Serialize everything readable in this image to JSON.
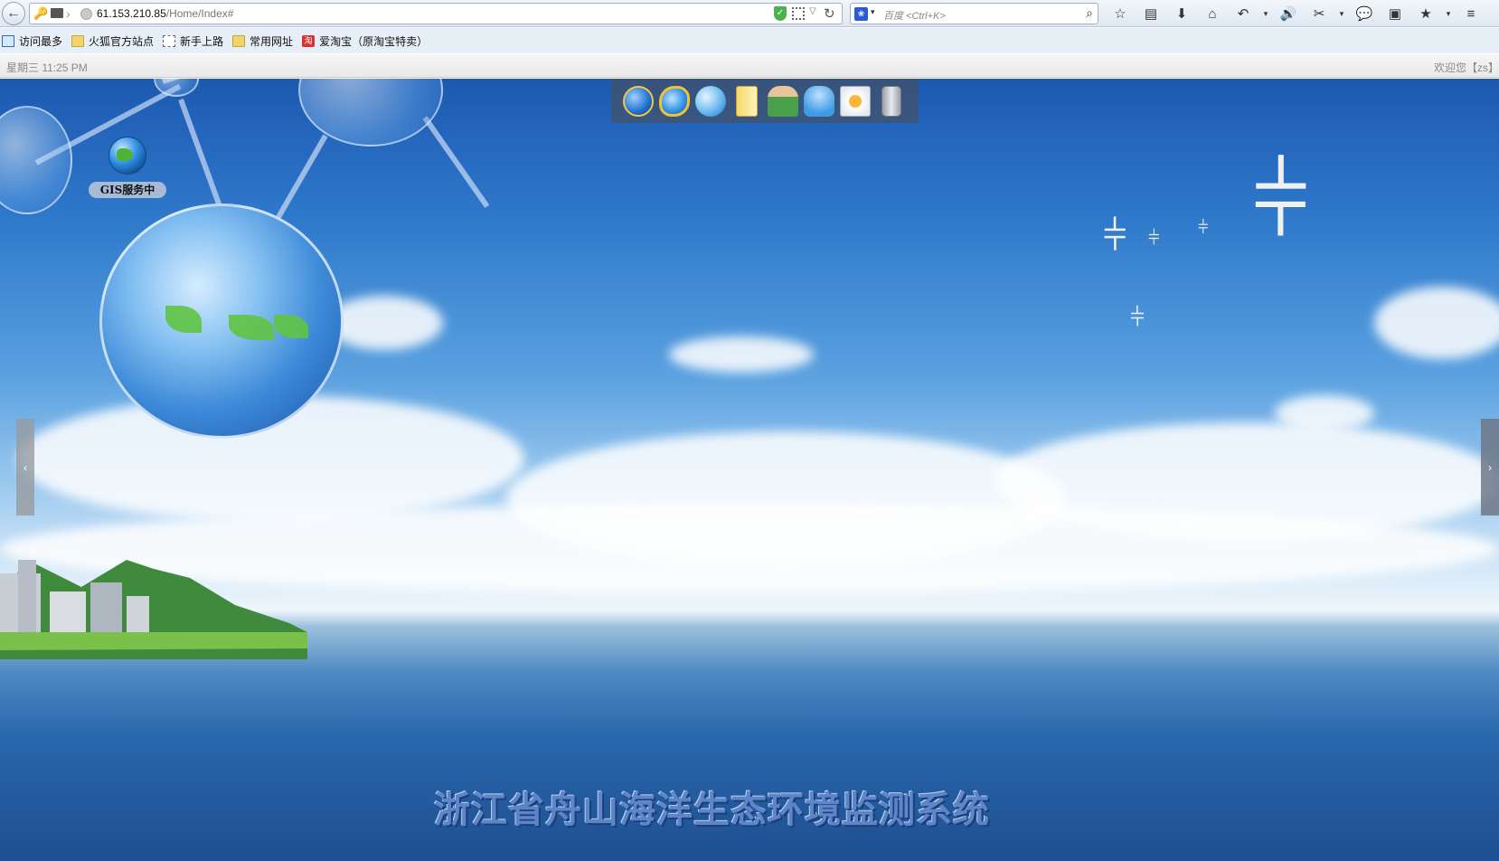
{
  "browser": {
    "url_host": "61.153.210.85",
    "url_path": "/Home/Index#",
    "search_placeholder": "百度 <Ctrl+K>",
    "bookmarks": [
      "访问最多",
      "火狐官方站点",
      "新手上路",
      "常用网址",
      "爱淘宝（原淘宝特卖）"
    ],
    "tools": [
      "star-icon",
      "clipboard-icon",
      "download-icon",
      "home-icon",
      "undo-icon",
      "speaker-icon",
      "crop-icon",
      "chat-icon",
      "reader-icon",
      "addon-icon",
      "menu-icon"
    ]
  },
  "status": {
    "clock": "星期三 11:25 PM",
    "welcome": "欢迎您【zs】"
  },
  "desktop": {
    "dock_items": [
      "network-settings-icon",
      "ie-browser-icon",
      "web-globe-icon",
      "folder-icon",
      "user-management-icon",
      "user-group-icon",
      "system-settings-icon",
      "database-icon"
    ],
    "desktop_icon_label": "GIS服务中",
    "system_title": "浙江省舟山海洋生态环境监测系统",
    "left_arrow": "‹",
    "right_arrow": "›"
  }
}
